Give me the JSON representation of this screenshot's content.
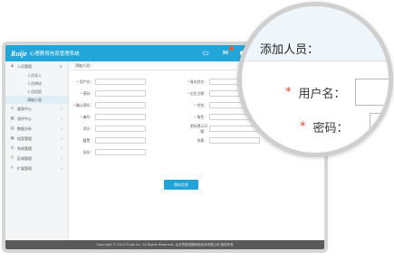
{
  "app": {
    "brand": "Ruije",
    "system_title": "心理教育信息管理系统"
  },
  "sidebar": {
    "items": [
      {
        "label": "人员管理",
        "icon": "user-icon",
        "arrow": "∨"
      },
      {
        "label": "量表中心",
        "icon": "list-icon",
        "arrow": "›"
      },
      {
        "label": "测评中心",
        "icon": "grid-icon",
        "arrow": "›"
      },
      {
        "label": "数据分析",
        "icon": "chart-icon",
        "arrow": "›"
      },
      {
        "label": "档案管理",
        "icon": "folder-icon",
        "arrow": "›"
      },
      {
        "label": "系统管理",
        "icon": "settings-icon",
        "arrow": "›"
      },
      {
        "label": "区域管理",
        "icon": "location-icon",
        "arrow": "›"
      },
      {
        "label": "扩展管理",
        "icon": "tool-icon",
        "arrow": "›"
      }
    ],
    "subitems": [
      "人员导入",
      "人员审核",
      "人员档案",
      "添加人员"
    ]
  },
  "form": {
    "section_title": "添加人员：",
    "fields": [
      {
        "label": "用户名：",
        "required": true
      },
      {
        "label": "真实姓名：",
        "required": true
      },
      {
        "label": "密码：",
        "required": true
      },
      {
        "label": "出生日期：",
        "required": true
      },
      {
        "label": "确认密码：",
        "required": true
      },
      {
        "label": "性别：",
        "required": true
      },
      {
        "label": "编号：",
        "required": true
      },
      {
        "label": "角色：",
        "required": true
      },
      {
        "label": "学历：",
        "required": false
      },
      {
        "label": "密码提示问题：",
        "required": false
      },
      {
        "label": "籍贯：",
        "required": false
      },
      {
        "label": "答案：",
        "required": false
      },
      {
        "label": "身份：",
        "required": false
      }
    ],
    "save_label": "保存信息"
  },
  "footer": {
    "text": "Copyright © 2014 Ruijie Inc. All Rights Reserved. 北京思维锐捷网络技术有限公司 版权所有"
  },
  "zoom": {
    "title": "添加人员：",
    "rows": [
      {
        "label": "用户名：",
        "required": true
      },
      {
        "label": "密码：",
        "required": true
      }
    ]
  },
  "colors": {
    "accent": "#22a6d9",
    "required": "#e8452c"
  }
}
